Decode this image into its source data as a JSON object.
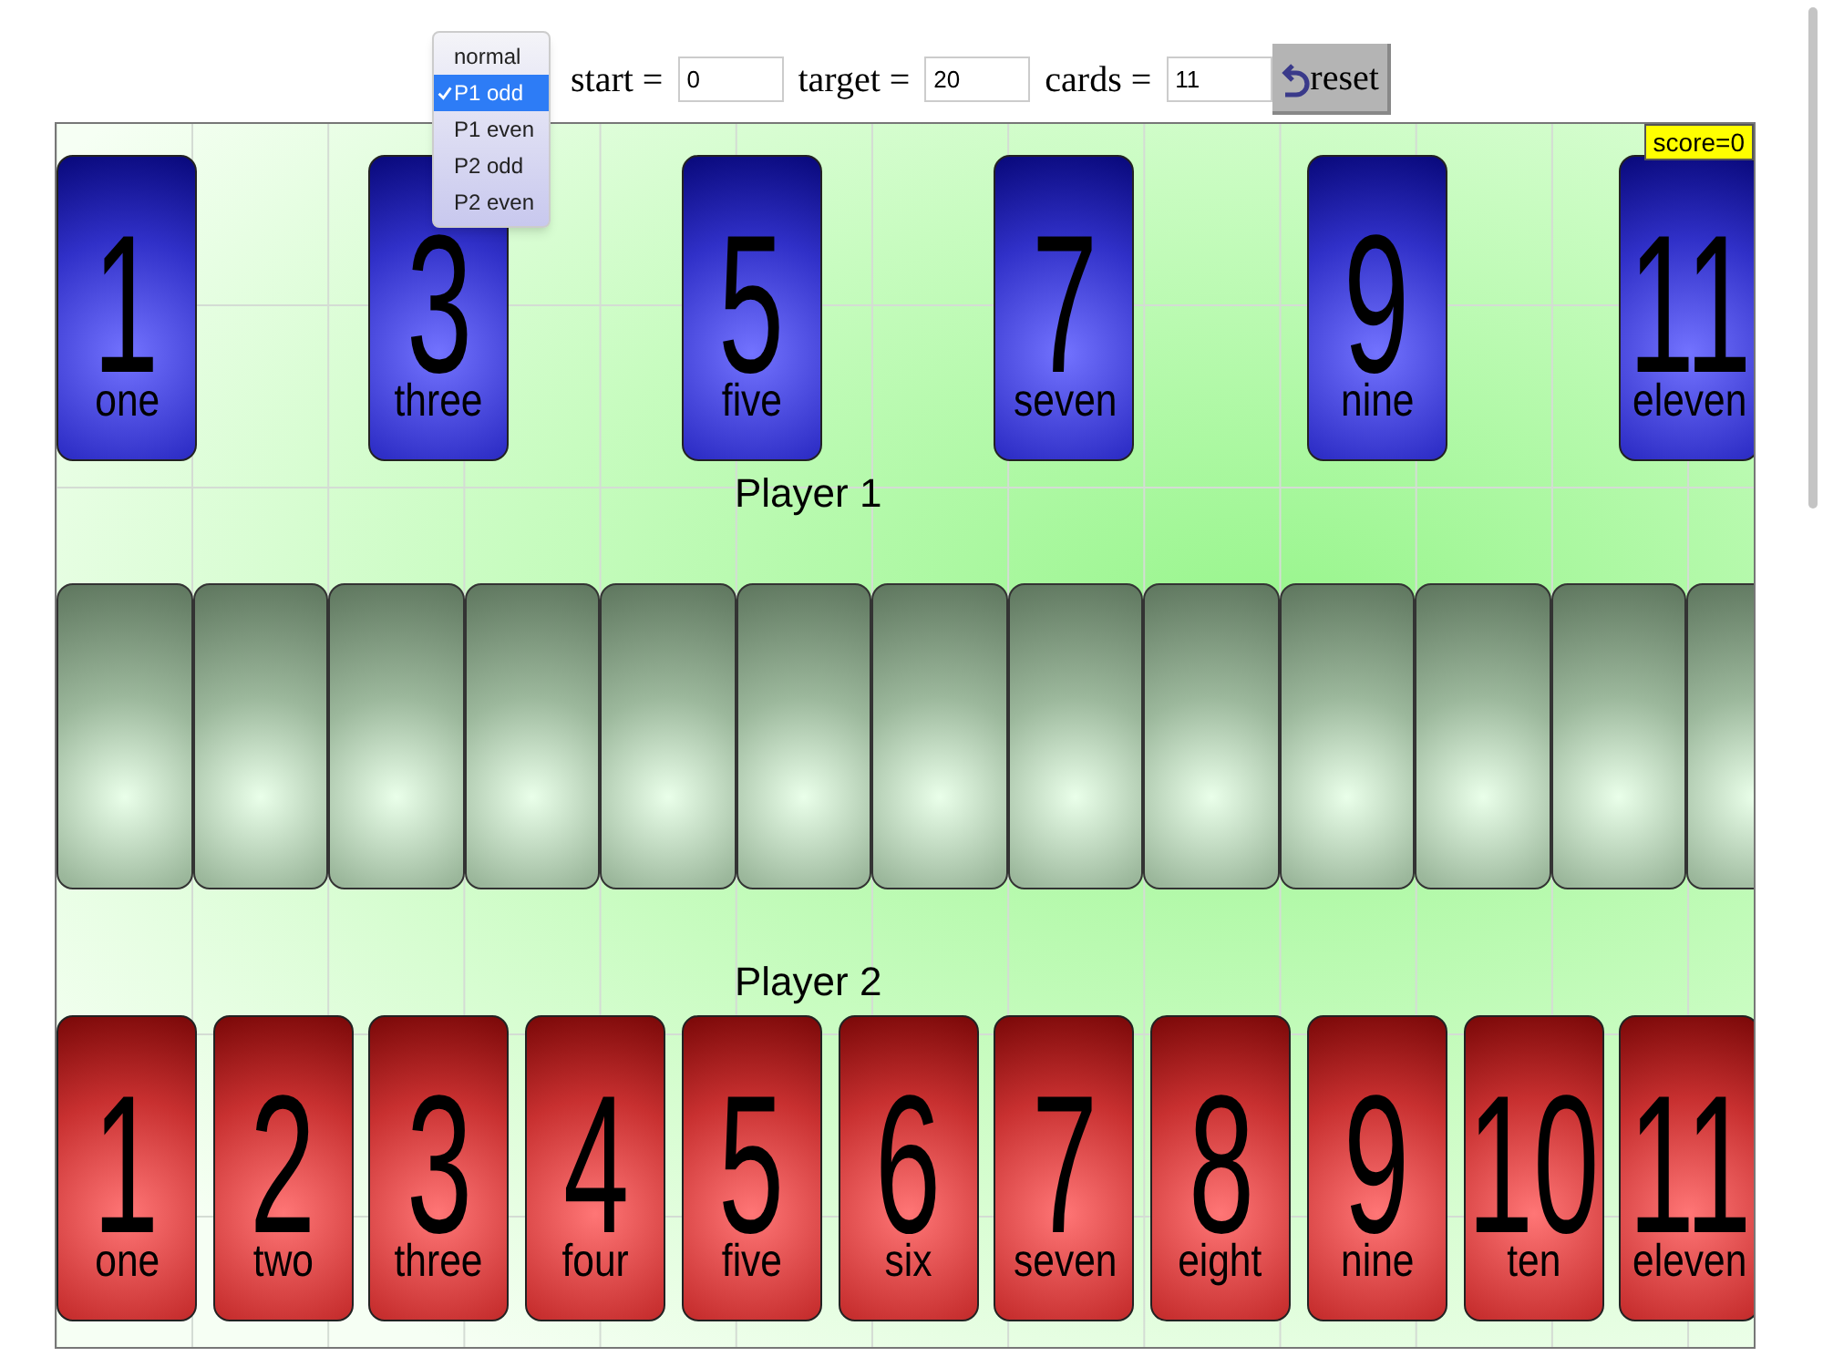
{
  "mode_menu": {
    "options": [
      {
        "label": "normal",
        "selected": false
      },
      {
        "label": "P1 odd",
        "selected": true
      },
      {
        "label": "P1 even",
        "selected": false
      },
      {
        "label": "P2 odd",
        "selected": false
      },
      {
        "label": "P2 even",
        "selected": false
      }
    ]
  },
  "fields": [
    {
      "label": "start =",
      "value": "0"
    },
    {
      "label": "target =",
      "value": "20"
    },
    {
      "label": "cards =",
      "value": "11"
    }
  ],
  "reset_button": {
    "label": "reset"
  },
  "board": {
    "score": "score=0",
    "player1": {
      "label": "Player 1",
      "slots": [
        {
          "kind": "card",
          "number": "1",
          "word": "one"
        },
        {
          "kind": "empty"
        },
        {
          "kind": "card",
          "number": "3",
          "word": "three"
        },
        {
          "kind": "empty"
        },
        {
          "kind": "card",
          "number": "5",
          "word": "five"
        },
        {
          "kind": "empty"
        },
        {
          "kind": "card",
          "number": "7",
          "word": "seven"
        },
        {
          "kind": "empty"
        },
        {
          "kind": "card",
          "number": "9",
          "word": "nine"
        },
        {
          "kind": "empty"
        },
        {
          "kind": "card",
          "number": "11",
          "word": "eleven"
        }
      ]
    },
    "table_cards": [
      {
        "kind": "face-down"
      },
      {
        "kind": "face-down"
      },
      {
        "kind": "face-down"
      },
      {
        "kind": "face-down"
      },
      {
        "kind": "face-down"
      },
      {
        "kind": "face-down"
      },
      {
        "kind": "face-down"
      },
      {
        "kind": "face-down"
      },
      {
        "kind": "face-down"
      },
      {
        "kind": "face-down"
      },
      {
        "kind": "face-down"
      },
      {
        "kind": "face-down"
      },
      {
        "kind": "face-down"
      }
    ],
    "player2": {
      "label": "Player 2",
      "slots": [
        {
          "kind": "card",
          "number": "1",
          "word": "one"
        },
        {
          "kind": "card",
          "number": "2",
          "word": "two"
        },
        {
          "kind": "card",
          "number": "3",
          "word": "three"
        },
        {
          "kind": "card",
          "number": "4",
          "word": "four"
        },
        {
          "kind": "card",
          "number": "5",
          "word": "five"
        },
        {
          "kind": "card",
          "number": "6",
          "word": "six"
        },
        {
          "kind": "card",
          "number": "7",
          "word": "seven"
        },
        {
          "kind": "card",
          "number": "8",
          "word": "eight"
        },
        {
          "kind": "card",
          "number": "9",
          "word": "nine"
        },
        {
          "kind": "card",
          "number": "10",
          "word": "ten"
        },
        {
          "kind": "card",
          "number": "11",
          "word": "eleven"
        }
      ]
    }
  }
}
